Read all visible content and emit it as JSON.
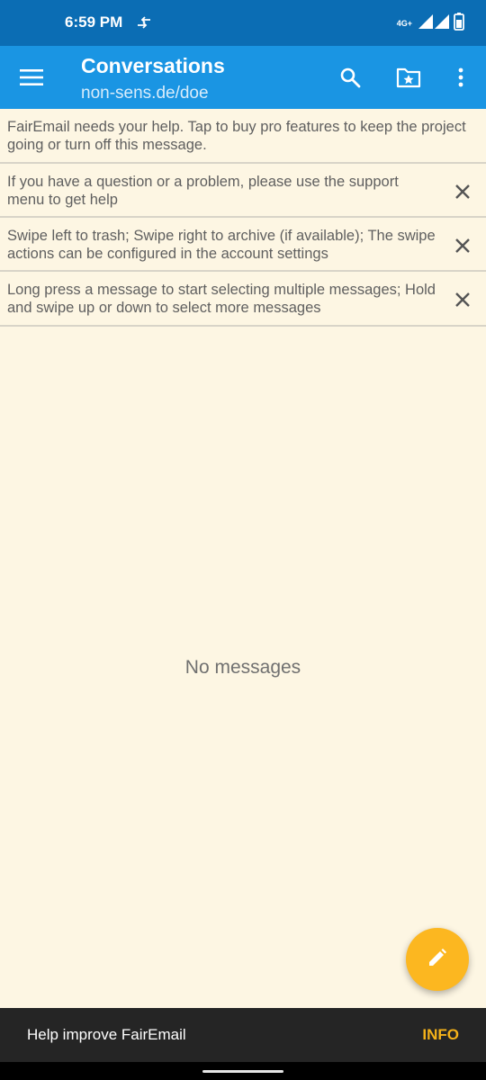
{
  "status_bar": {
    "time": "6:59 PM",
    "network_type": "4G+",
    "icons": [
      "data-transfer-icon",
      "signal-icon",
      "battery-icon"
    ]
  },
  "app_bar": {
    "title": "Conversations",
    "subtitle": "non-sens.de/doe",
    "icons": [
      "menu-icon",
      "search-icon",
      "folder-star-icon",
      "more-vert-icon"
    ]
  },
  "banners": [
    {
      "text": "FairEmail needs your help. Tap to buy pro features to keep the project going or turn off this message."
    },
    {
      "text": "If you have a question or a problem, please use the support menu to get help"
    },
    {
      "text": "Swipe left to trash; Swipe right to archive (if available); The swipe actions can be configured in the account settings"
    },
    {
      "text": "Long press a message to start selecting multiple messages; Hold and swipe up or down to select more messages"
    }
  ],
  "empty_state": {
    "text": "No messages"
  },
  "fab": {
    "icon": "edit-icon",
    "color": "#fcb720"
  },
  "snackbar": {
    "text": "Help improve FairEmail",
    "action": "INFO"
  },
  "colors": {
    "status_bar": "#0b6db4",
    "app_bar": "#1a95e3",
    "background": "#fdf6e3",
    "accent": "#f5b219"
  }
}
